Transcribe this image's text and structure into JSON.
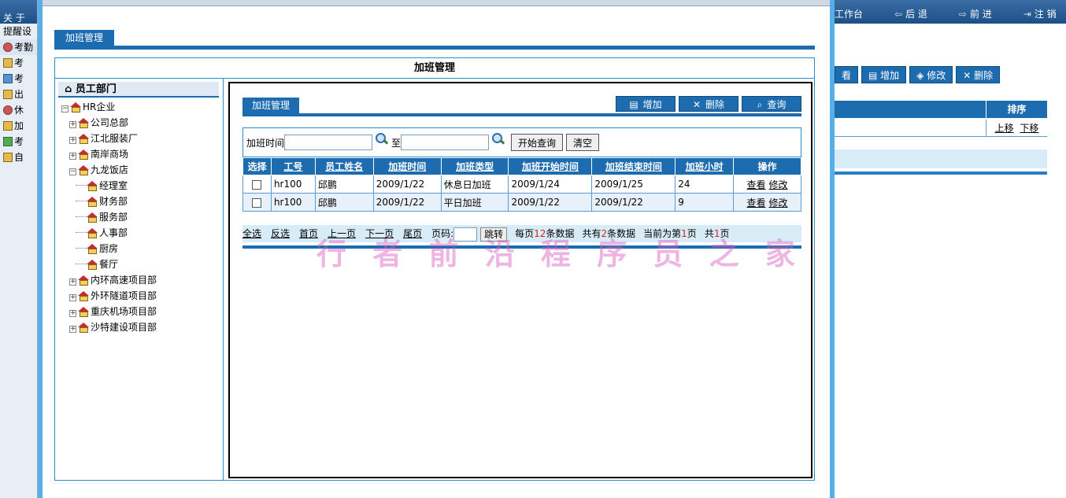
{
  "background_left": {
    "top_label": "关 于",
    "items": [
      {
        "label": "提醒设"
      },
      {
        "label": "考勤"
      },
      {
        "label": "考"
      },
      {
        "label": "考"
      },
      {
        "label": "出"
      },
      {
        "label": "休"
      },
      {
        "label": "加"
      },
      {
        "label": "考"
      },
      {
        "label": "自"
      }
    ]
  },
  "background_right": {
    "nav": [
      {
        "label": "工作台"
      },
      {
        "label": "后 退"
      },
      {
        "label": "前 进"
      },
      {
        "label": "注 销"
      }
    ],
    "actions": [
      {
        "label": "看"
      },
      {
        "label": "增加"
      },
      {
        "label": "修改"
      },
      {
        "label": "删除"
      }
    ],
    "sort_header": "排序",
    "move_up": "上移",
    "move_down": "下移"
  },
  "page": {
    "tab_label": "加班管理",
    "panel_title": "加班管理"
  },
  "tree": {
    "header": "员工部门",
    "root": "HR企业",
    "nodes": [
      {
        "label": "公司总部"
      },
      {
        "label": "江北服装厂"
      },
      {
        "label": "南岸商场"
      },
      {
        "label": "九龙饭店"
      },
      {
        "label": "经理室"
      },
      {
        "label": "财务部"
      },
      {
        "label": "服务部"
      },
      {
        "label": "人事部"
      },
      {
        "label": "厨房"
      },
      {
        "label": "餐厅"
      },
      {
        "label": "内环高速项目部"
      },
      {
        "label": "外环隧道项目部"
      },
      {
        "label": "重庆机场项目部"
      },
      {
        "label": "沙特建设项目部"
      }
    ]
  },
  "content": {
    "tab_label": "加班管理",
    "buttons": {
      "add": "增加",
      "delete": "删除",
      "query": "查询"
    },
    "search": {
      "label": "加班时间",
      "to": "至",
      "start_value": "",
      "end_value": "",
      "search_button": "开始查询",
      "clear_button": "清空"
    },
    "columns": [
      "选择",
      "工号",
      "员工姓名",
      "加班时间",
      "加班类型",
      "加班开始时间",
      "加班结束时间",
      "加班小时",
      "操作"
    ],
    "rows": [
      {
        "id": "hr100",
        "name": "邱鹏",
        "date": "2009/1/22",
        "type": "休息日加班",
        "start": "2009/1/24",
        "end": "2009/1/25",
        "hours": "24",
        "view": "查看",
        "edit": "修改"
      },
      {
        "id": "hr100",
        "name": "邱鹏",
        "date": "2009/1/22",
        "type": "平日加班",
        "start": "2009/1/22",
        "end": "2009/1/22",
        "hours": "9",
        "view": "查看",
        "edit": "修改"
      }
    ],
    "pager": {
      "select_all": "全选",
      "invert": "反选",
      "first": "首页",
      "prev": "上一页",
      "next": "下一页",
      "last": "尾页",
      "page_label": "页码:",
      "jump": "跳转",
      "per_page_prefix": "每页",
      "per_page": "12",
      "per_page_suffix": "条数据",
      "total_prefix": "共有",
      "total": "2",
      "total_suffix": "条数据",
      "current_prefix": "当前为第",
      "current": "1",
      "current_suffix": "页",
      "pages_prefix": "共",
      "pages": "1",
      "pages_suffix": "页"
    }
  },
  "watermark": "行 者 前 沿 程 序 员 之 家",
  "colors": {
    "accent": "#1e6cb0",
    "border": "#2a8fd0",
    "pager_bg": "#d8ecf7",
    "highlight": "#e02020"
  }
}
